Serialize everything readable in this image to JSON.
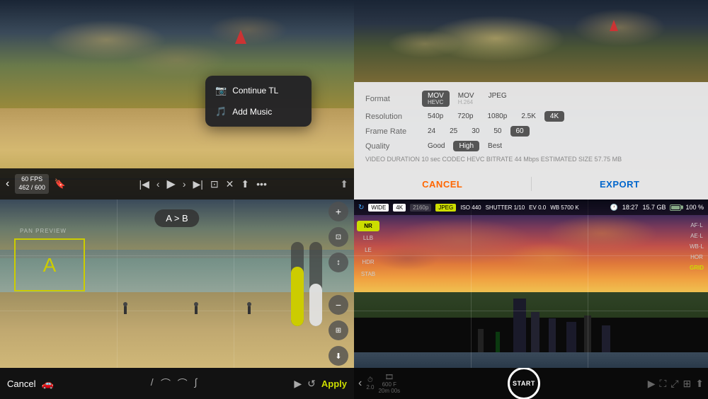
{
  "topleft": {
    "fps_line1": "60 FPS",
    "fps_line2": "462 / 600",
    "context_menu": {
      "item1": "Continue TL",
      "item2": "Add Music"
    }
  },
  "topright": {
    "export_panel": {
      "format_label": "Format",
      "format_options": [
        "MOV HEVC",
        "MOV H.264",
        "JPEG"
      ],
      "format_selected": "MOV HEVC",
      "resolution_label": "Resolution",
      "resolution_options": [
        "540p",
        "720p",
        "1080p",
        "2.5K",
        "4K"
      ],
      "resolution_selected": "4K",
      "framerate_label": "Frame Rate",
      "framerate_options": [
        "24",
        "25",
        "30",
        "50",
        "60"
      ],
      "framerate_selected": "60",
      "quality_label": "Quality",
      "quality_options": [
        "Good",
        "High",
        "Best"
      ],
      "quality_selected": "High",
      "meta": "VIDEO DURATION  10 sec   CODEC  HEVC   BITRATE  44 Mbps   ESTIMATED SIZE  57.75 MB"
    },
    "cancel_label": "CANCEL",
    "export_label": "EXPORT"
  },
  "bottomleft": {
    "ab_label": "A > B",
    "pan_preview_label": "PAN PREVIEW",
    "box_label": "A",
    "cancel_label": "Cancel",
    "apply_label": "Apply"
  },
  "bottomright": {
    "hud": {
      "wide": "WIDE",
      "resolution": "4K",
      "subres": "2160p",
      "format": "JPEG",
      "iso": "ISO 440",
      "shutter": "SHUTTER 1/10",
      "ev": "EV 0.0",
      "wb": "WB 5700 K",
      "time": "18:27",
      "storage": "15.7 GB",
      "battery": "100 %"
    },
    "left_options": [
      "NR",
      "LLB",
      "LE",
      "HDR",
      "STAB"
    ],
    "left_active": "NR",
    "right_options": [
      "AF·L",
      "AE·L",
      "WB·L",
      "HOR",
      "GRID"
    ],
    "right_active": "GRID",
    "bottom": {
      "timer_value": "2.0",
      "frames": "600 F",
      "duration": "20m 00s",
      "start_label": "START"
    }
  },
  "colors": {
    "accent_yellow": "#ccdd00",
    "accent_orange": "#ff6600",
    "accent_blue": "#0066cc",
    "highlight_yellow": "#cccc00"
  }
}
